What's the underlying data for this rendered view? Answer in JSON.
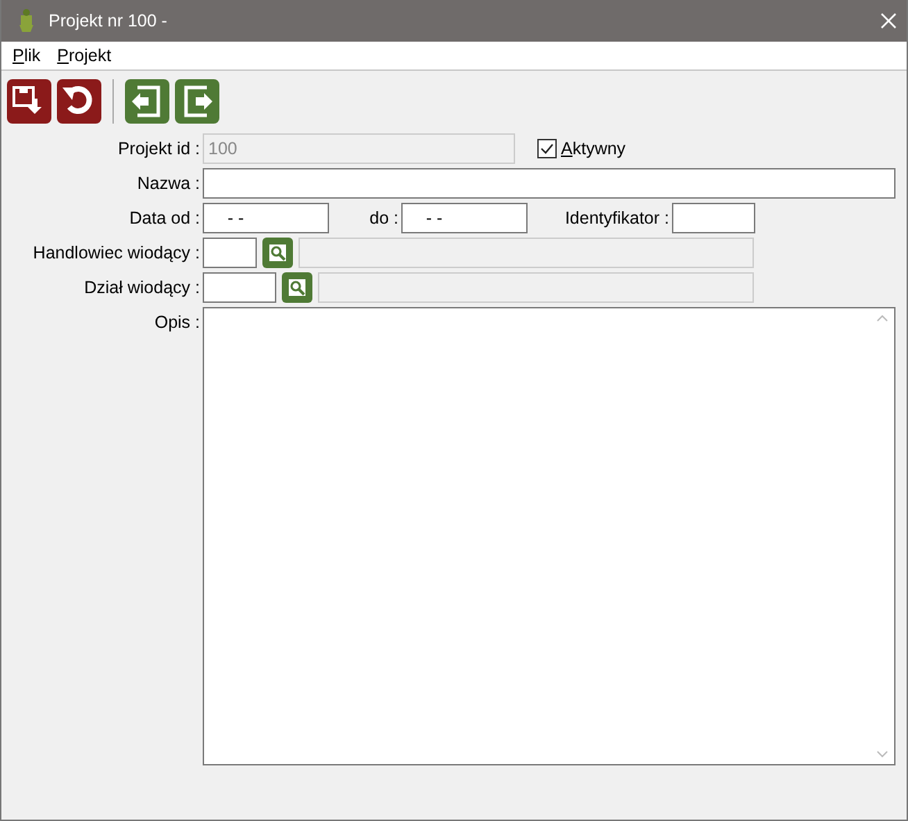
{
  "window": {
    "title": "Projekt nr 100 -"
  },
  "menu": [
    {
      "label": "Plik"
    },
    {
      "label": "Projekt"
    }
  ],
  "toolbar": [
    {
      "kind": "save",
      "color": "#8b1a1a"
    },
    {
      "kind": "undo",
      "color": "#8b1a1a"
    },
    {
      "kind": "prev",
      "color": "#4f7a35"
    },
    {
      "kind": "next",
      "color": "#4f7a35"
    }
  ],
  "form": {
    "project_id": {
      "label": "Projekt id :",
      "value": "100",
      "disabled": true
    },
    "active": {
      "label": "Aktywny",
      "checked": true
    },
    "name": {
      "label": "Nazwa :"
    },
    "date_from": {
      "label": "Data od :",
      "value": "- -"
    },
    "date_to": {
      "label": "do :",
      "value": "- -"
    },
    "identifier": {
      "label": "Identyfikator :"
    },
    "salesperson": {
      "label": "Handlowiec wiodący :"
    },
    "department": {
      "label": "Dział wiodący :"
    },
    "description": {
      "label": "Opis :"
    }
  }
}
